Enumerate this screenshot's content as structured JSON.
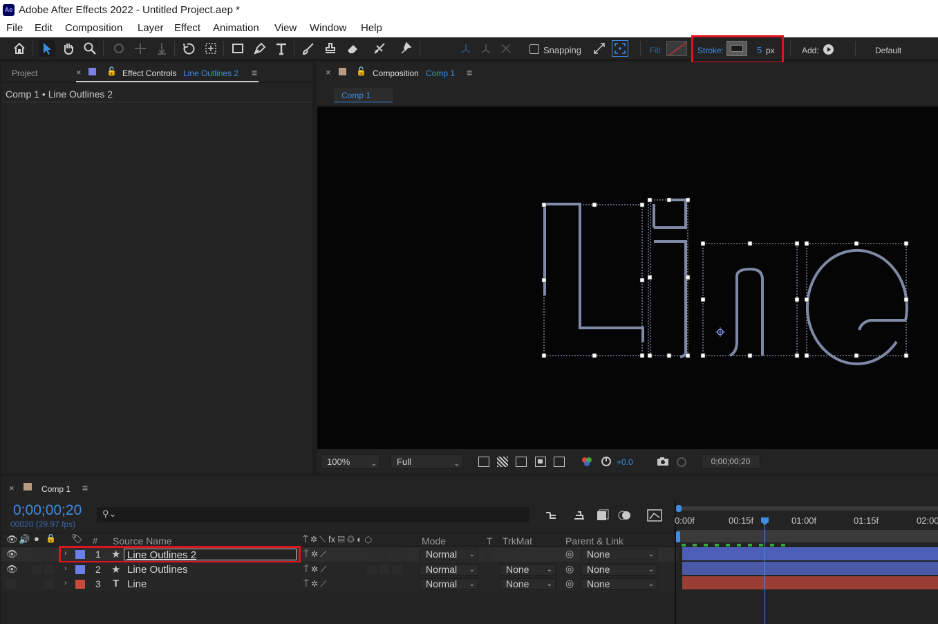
{
  "app": {
    "icon": "Ae",
    "title": "Adobe After Effects 2022 - Untitled Project.aep *"
  },
  "menu": [
    "File",
    "Edit",
    "Composition",
    "Layer",
    "Effect",
    "Animation",
    "View",
    "Window",
    "Help"
  ],
  "toolbar": {
    "snapping_label": "Snapping",
    "fill_label": "Fill:",
    "stroke_label": "Stroke:",
    "stroke_width": "5",
    "stroke_unit": "px",
    "add_label": "Add:",
    "workspace": "Default"
  },
  "left_panel": {
    "tab_project": "Project",
    "tab_effect_controls": "Effect Controls",
    "tab_effect_layer": "Line Outlines 2",
    "breadcrumb": "Comp 1 • Line Outlines 2"
  },
  "comp_panel": {
    "tab_label": "Composition",
    "tab_comp": "Comp 1",
    "subtab": "Comp 1",
    "zoom": "100%",
    "resolution": "Full",
    "exposure": "+0.0",
    "timecode": "0;00;00;20"
  },
  "timeline": {
    "tab": "Comp 1",
    "current_time": "0;00;00;20",
    "frame_info": "00020 (29.97 fps)",
    "columns": {
      "hash": "#",
      "source_name": "Source Name",
      "mode": "Mode",
      "t": "T",
      "trkmat": "TrkMat",
      "parent": "Parent & Link"
    },
    "ruler": [
      "0:00f",
      "00:15f",
      "01:00f",
      "01:15f",
      "02:00"
    ],
    "playhead_fraction": 0.2,
    "layers": [
      {
        "num": "1",
        "name": "Line Outlines 2",
        "type": "shape",
        "mode": "Normal",
        "trkmat": "",
        "parent": "None",
        "label_color": "#6b7fe6",
        "bar_color": "#4c5fb8",
        "visible": true
      },
      {
        "num": "2",
        "name": "Line Outlines",
        "type": "shape",
        "mode": "Normal",
        "trkmat": "None",
        "parent": "None",
        "label_color": "#6b7fe6",
        "bar_color": "#4c5fb8",
        "visible": true
      },
      {
        "num": "3",
        "name": "Line",
        "type": "text",
        "mode": "Normal",
        "trkmat": "None",
        "parent": "None",
        "label_color": "#c94a3d",
        "bar_color": "#9c3e36",
        "visible": false
      }
    ]
  },
  "colors": {
    "accent": "#3d8de6",
    "highlight": "#e0141e",
    "canvas": "#050505"
  }
}
